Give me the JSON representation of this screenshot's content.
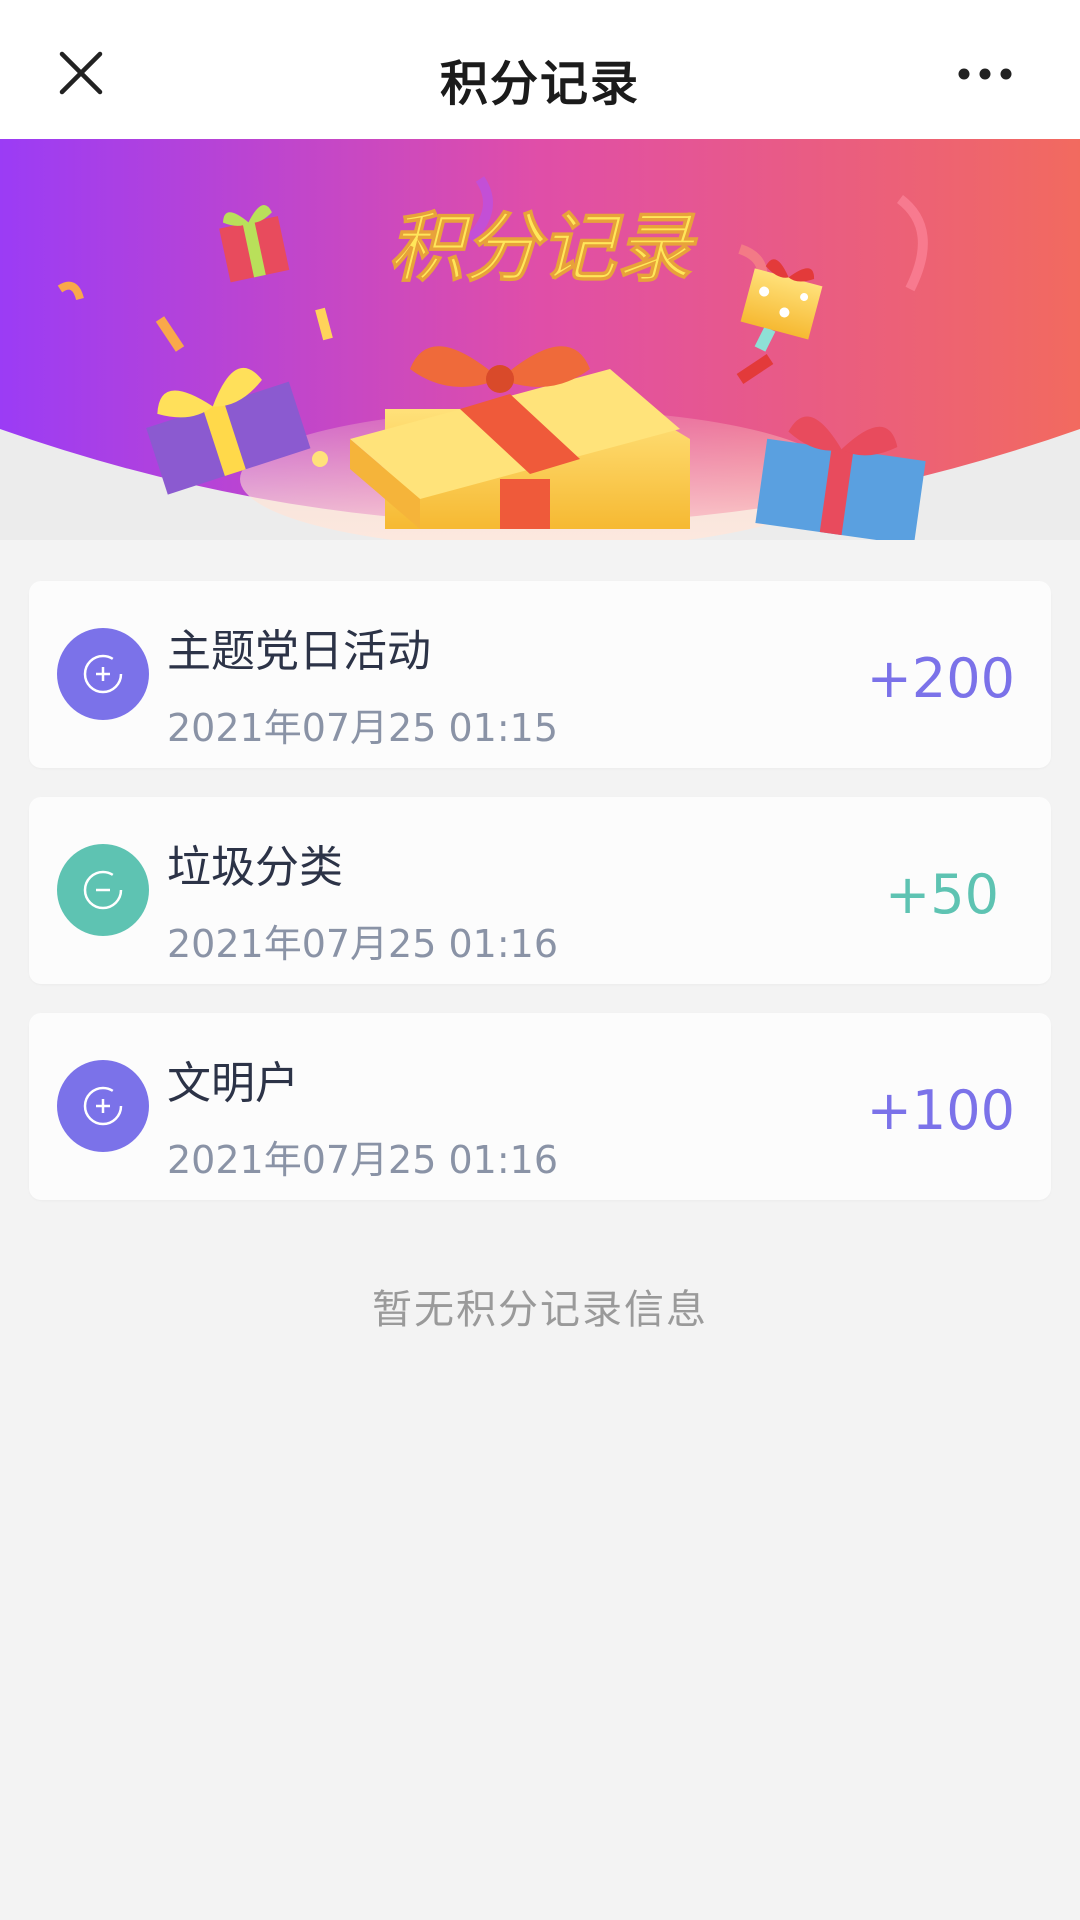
{
  "header": {
    "title": "积分记录",
    "close_icon": "close-icon",
    "more_icon": "more-horizontal-icon"
  },
  "banner": {
    "title": "积分记录",
    "colors": {
      "gradient_left": "#9b3cf5",
      "gradient_mid": "#e04ea8",
      "gradient_right": "#f26a5f",
      "title_color": "#ffe75a"
    }
  },
  "records": [
    {
      "name": "主题党日活动",
      "time": "2021年07月25 01:15",
      "points": "+200",
      "icon": "plus-circle-icon",
      "color": "#7b72e9"
    },
    {
      "name": "垃圾分类",
      "time": "2021年07月25 01:16",
      "points": "+50",
      "icon": "minus-circle-icon",
      "color": "#5ec3b2"
    },
    {
      "name": "文明户",
      "time": "2021年07月25 01:16",
      "points": "+100",
      "icon": "plus-circle-icon",
      "color": "#7b72e9"
    }
  ],
  "empty_message": "暂无积分记录信息"
}
